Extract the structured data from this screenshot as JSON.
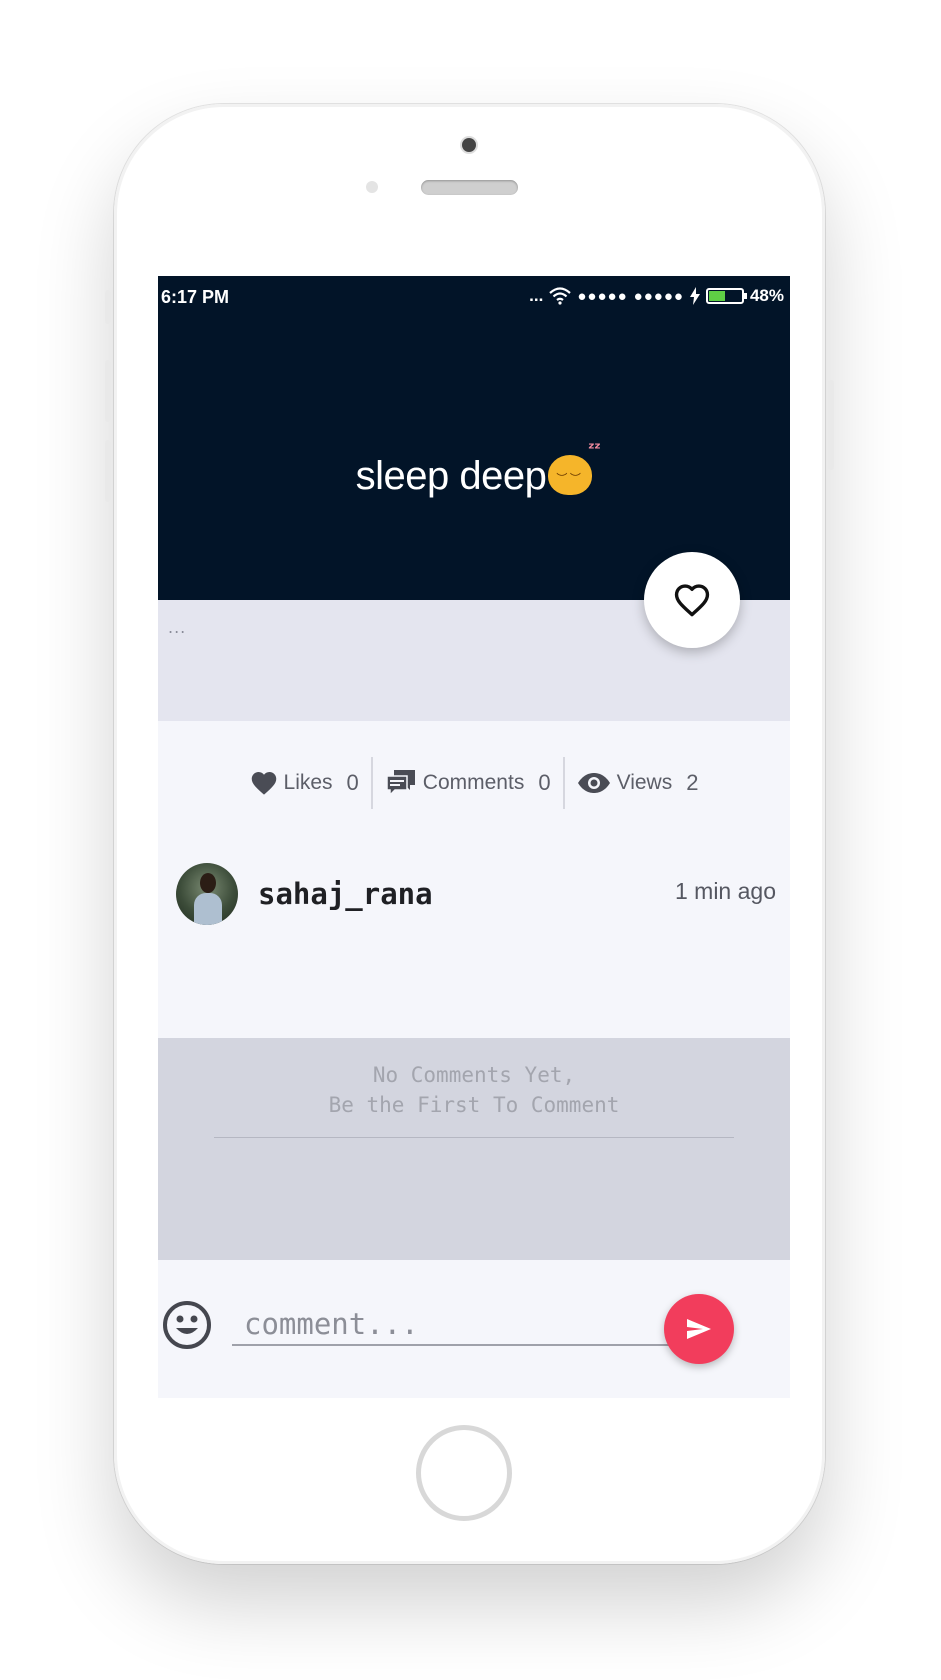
{
  "status_bar": {
    "time": "6:17 PM",
    "signal": "...",
    "sim1": "●●●●●",
    "sim2": "●●●●●",
    "battery_percent": "48%",
    "battery_level": 0.48,
    "icons": [
      "wifi-icon",
      "charging-bolt-icon",
      "battery-icon"
    ]
  },
  "post": {
    "text": "sleep deep",
    "emoji": "sleeping-face-emoji",
    "background_color": "#021428",
    "more_label": "...",
    "like_fab_icon": "heart-outline-icon"
  },
  "stats": {
    "likes": {
      "label": "Likes",
      "count": "0",
      "icon": "heart-icon"
    },
    "comments": {
      "label": "Comments",
      "count": "0",
      "icon": "comments-icon"
    },
    "views": {
      "label": "Views",
      "count": "2",
      "icon": "eye-icon"
    }
  },
  "author": {
    "username": "sahaj_rana",
    "time_ago": "1 min ago"
  },
  "comments": {
    "empty_message": "No Comments Yet,\nBe the First To Comment"
  },
  "composer": {
    "placeholder": "comment...",
    "value": "",
    "emoji_icon": "smiley-icon",
    "send_icon": "send-icon"
  },
  "colors": {
    "accent": "#f23d5c",
    "post_bg": "#021428",
    "battery_green": "#5fcf45"
  }
}
